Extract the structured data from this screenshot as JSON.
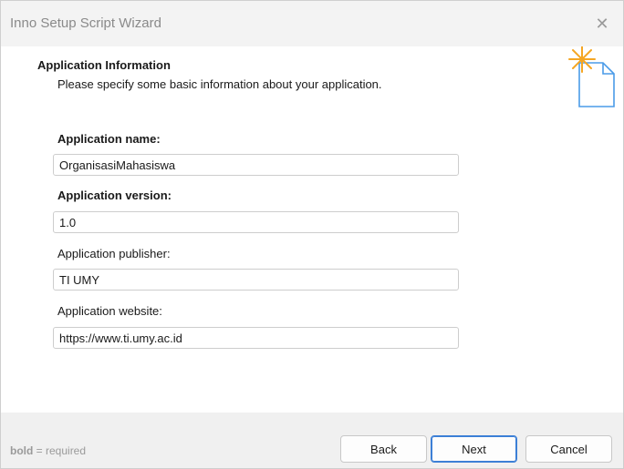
{
  "window": {
    "title": "Inno Setup Script Wizard",
    "close_glyph": "✕"
  },
  "header": {
    "title": "Application Information",
    "description": "Please specify some basic information about your application.",
    "icon": "wizard-sparkle-document-icon"
  },
  "fields": {
    "name": {
      "label": "Application name:",
      "value": "OrganisasiMahasiswa",
      "required": true
    },
    "version": {
      "label": "Application version:",
      "value": "1.0",
      "required": true
    },
    "publisher": {
      "label": "Application publisher:",
      "value": "TI UMY",
      "required": false
    },
    "website": {
      "label": "Application website:",
      "value": "https://www.ti.umy.ac.id",
      "required": false
    }
  },
  "footer": {
    "hint_bold": "bold",
    "hint_rest": " = required",
    "back_label": "Back",
    "next_label": "Next",
    "cancel_label": "Cancel"
  },
  "colors": {
    "accent": "#3c7fd6",
    "star": "#f5a623",
    "document": "#4a9be8"
  }
}
